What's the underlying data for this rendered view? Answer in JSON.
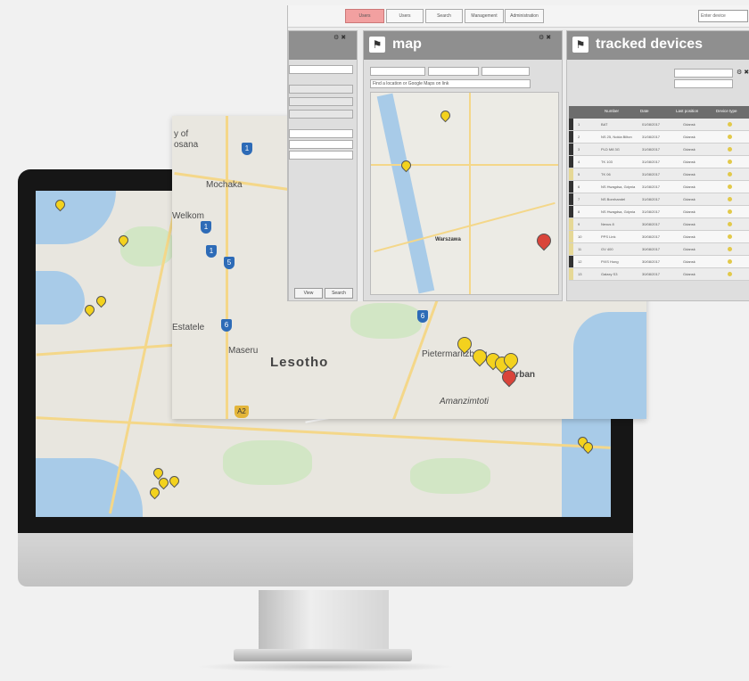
{
  "topbar": {
    "buttons": [
      "Users",
      "Users",
      "Search",
      "Management",
      "Administration"
    ],
    "search_placeholder": "Enter device"
  },
  "left_panel": {
    "buttons": [
      "View",
      "Search"
    ]
  },
  "map_panel": {
    "title": "map",
    "search_hint": "Find a location or Google Maps on link",
    "city_label": "Warszawa"
  },
  "devices_panel": {
    "title": "tracked devices",
    "columns": [
      "Number",
      "Date",
      "Last position",
      "Device type"
    ],
    "rows": [
      {
        "id": "1",
        "name": "BAT",
        "date": "01/08/2017",
        "pos": "Gdansk",
        "flag": "#333"
      },
      {
        "id": "2",
        "name": "NS 25, Nokia Bilton",
        "date": "31/08/2017",
        "pos": "Gdansk",
        "flag": "#333"
      },
      {
        "id": "3",
        "name": "PLD M8 3G",
        "date": "31/08/2017",
        "pos": "Gdansk",
        "flag": "#333"
      },
      {
        "id": "4",
        "name": "TK 103",
        "date": "31/08/2017",
        "pos": "Gdansk",
        "flag": "#333"
      },
      {
        "id": "5",
        "name": "TK 06",
        "date": "31/08/2017",
        "pos": "Gdansk",
        "flag": "#e6d896"
      },
      {
        "id": "6",
        "name": "NS Hwagdsa, Gdynia",
        "date": "31/08/2017",
        "pos": "Gdansk",
        "flag": "#333"
      },
      {
        "id": "7",
        "name": "NS Bornhandel",
        "date": "31/08/2017",
        "pos": "Gdansk",
        "flag": "#333"
      },
      {
        "id": "8",
        "name": "NS Hwagdsa, Gdynia",
        "date": "31/08/2017",
        "pos": "Gdansk",
        "flag": "#333"
      },
      {
        "id": "9",
        "name": "Nexus 8",
        "date": "30/08/2017",
        "pos": "Gdansk",
        "flag": "#e6d896"
      },
      {
        "id": "10",
        "name": "PPS Link",
        "date": "30/08/2017",
        "pos": "Gdansk",
        "flag": "#e6d896"
      },
      {
        "id": "11",
        "name": "GV 400",
        "date": "30/08/2017",
        "pos": "Gdansk",
        "flag": "#e6d896"
      },
      {
        "id": "12",
        "name": "PiXS Hong",
        "date": "30/08/2017",
        "pos": "Gdansk",
        "flag": "#333"
      },
      {
        "id": "13",
        "name": "Galaxy S3",
        "date": "30/08/2017",
        "pos": "Gdansk",
        "flag": "#e6d896"
      }
    ]
  },
  "lesotho_map": {
    "country_label": "Lesotho",
    "labels": [
      "y of",
      "osana",
      "Welkom",
      "Maseru",
      "Pietermaritzburg",
      "Durban",
      "Amanzimtoti",
      "Mochaka",
      "Estatele"
    ],
    "shields": [
      "1",
      "1",
      "5",
      "1",
      "6",
      "6",
      "A2"
    ]
  }
}
